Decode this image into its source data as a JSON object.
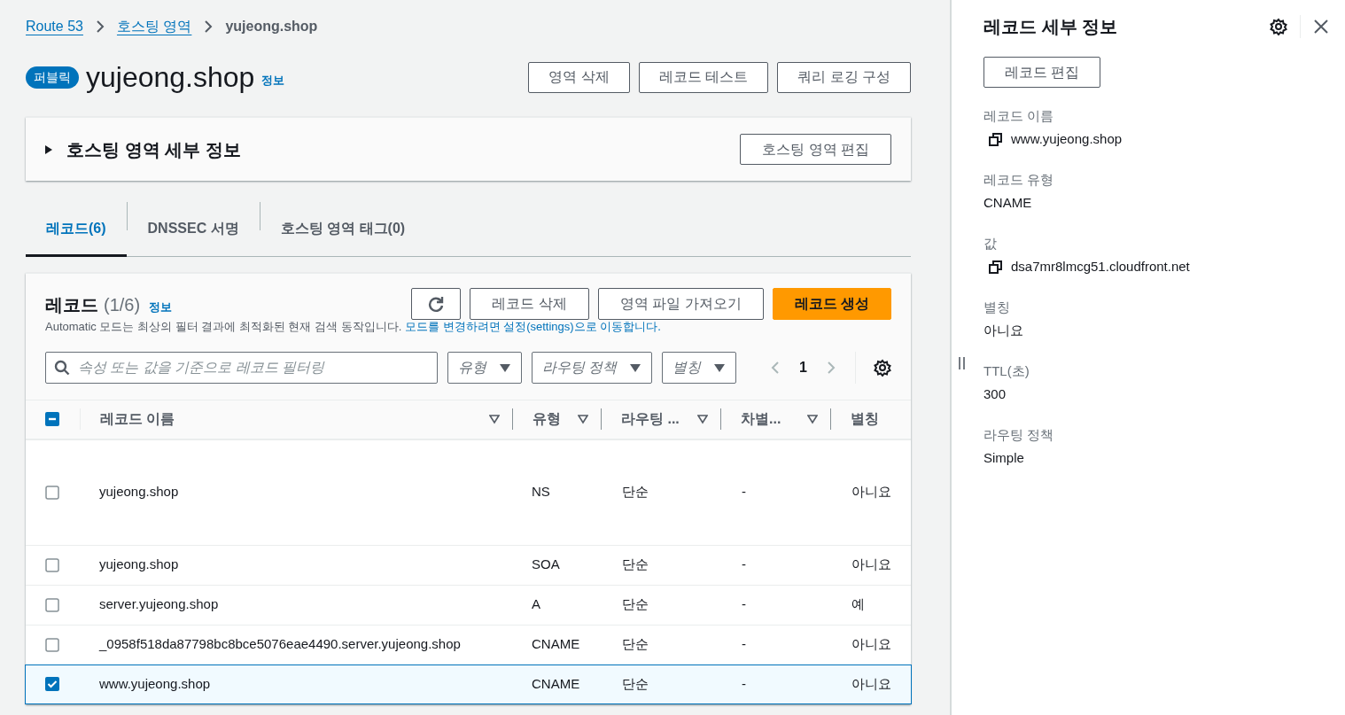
{
  "breadcrumbs": [
    {
      "label": "Route 53",
      "kind": "link"
    },
    {
      "label": "호스팅 영역",
      "kind": "link"
    },
    {
      "label": "yujeong.shop",
      "kind": "current"
    }
  ],
  "header": {
    "badge": "퍼블릭",
    "title": "yujeong.shop",
    "info": "정보",
    "buttons": [
      "영역 삭제",
      "레코드 테스트",
      "쿼리 로깅 구성"
    ]
  },
  "details_panel": {
    "title": "호스팅 영역 세부 정보",
    "expanded": false,
    "button": "호스팅 영역 편집"
  },
  "tabs": [
    {
      "label": "레코드(6)",
      "selected": true
    },
    {
      "label": "DNSSEC 서명",
      "selected": false
    },
    {
      "label": "호스팅 영역 태그(0)",
      "selected": false
    }
  ],
  "records": {
    "title": "레코드",
    "count": "(1/6)",
    "info": "정보",
    "buttons": [
      {
        "label": "레코드 삭제",
        "kind": "normal"
      },
      {
        "label": "영역 파일 가져오기",
        "kind": "normal"
      },
      {
        "label": "레코드 생성",
        "kind": "primary"
      }
    ],
    "description": {
      "text": "Automatic 모드는 최상의 필터 결과에 최적화된 현재 검색 동작입니다. ",
      "link": "모드를 변경하려면 설정(settings)으로 이동합니다."
    },
    "search": {
      "placeholder": "속성 또는 값을 기준으로 레코드 필터링"
    },
    "filters": [
      "유형",
      "라우팅 정책",
      "별칭"
    ],
    "page": "1",
    "header_checkbox": {
      "indeterminate": true
    },
    "columns": [
      "레코드 이름",
      "유형",
      "라우팅 ...",
      "차별...",
      "별칭"
    ],
    "rows": [
      {
        "name": "yujeong.shop",
        "type": "NS",
        "routing": "단순",
        "differentiator": "-",
        "alias": "아니요",
        "selected": false,
        "kind": "tall"
      },
      {
        "name": "yujeong.shop",
        "type": "SOA",
        "routing": "단순",
        "differentiator": "-",
        "alias": "아니요",
        "selected": false,
        "kind": "normal"
      },
      {
        "name": "server.yujeong.shop",
        "type": "A",
        "routing": "단순",
        "differentiator": "-",
        "alias": "예",
        "selected": false,
        "kind": "normal"
      },
      {
        "name": "_0958f518da87798bc8bce5076eae4490.server.yujeong.shop",
        "type": "CNAME",
        "routing": "단순",
        "differentiator": "-",
        "alias": "아니요",
        "selected": false,
        "kind": "normal"
      },
      {
        "name": "www.yujeong.shop",
        "type": "CNAME",
        "routing": "단순",
        "differentiator": "-",
        "alias": "아니요",
        "selected": true,
        "kind": "normal"
      }
    ]
  },
  "side_panel": {
    "title": "레코드 세부 정보",
    "button": "레코드 편집",
    "fields": [
      {
        "label": "레코드 이름",
        "value": "www.yujeong.shop",
        "copy": true
      },
      {
        "label": "레코드 유형",
        "value": "CNAME",
        "copy": false
      },
      {
        "label": "값",
        "value": "dsa7mr8lmcg51.cloudfront.net",
        "copy": true
      },
      {
        "label": "별칭",
        "value": "아니요",
        "copy": false
      },
      {
        "label": "TTL(초)",
        "value": "300",
        "copy": false
      },
      {
        "label": "라우팅 정책",
        "value": "Simple",
        "copy": false
      }
    ]
  }
}
